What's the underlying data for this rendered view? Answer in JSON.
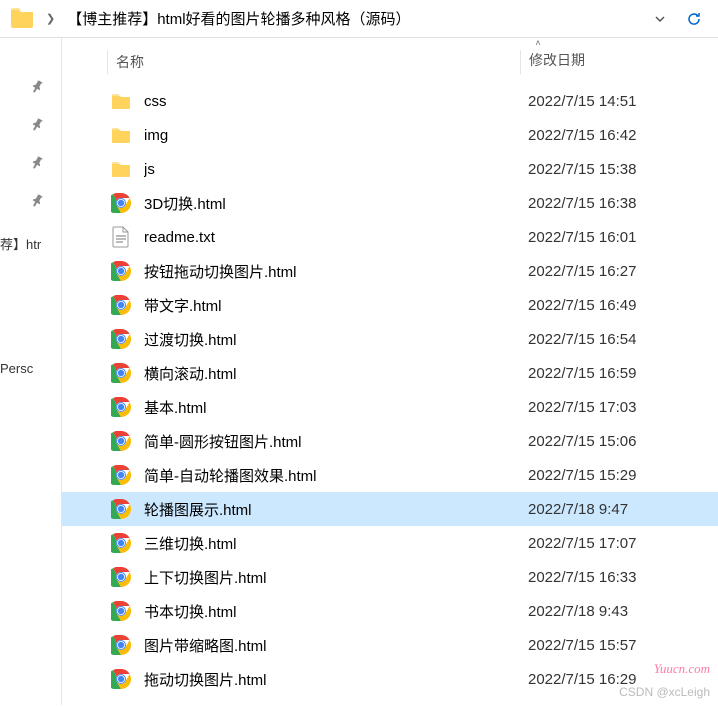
{
  "header": {
    "title": "【博主推荐】html好看的图片轮播多种风格（源码）"
  },
  "columns": {
    "name": "名称",
    "date": "修改日期"
  },
  "sidebar": {
    "item1": "荐】htr",
    "item2": "Persc"
  },
  "files": [
    {
      "icon": "folder",
      "name": "css",
      "date": "2022/7/15 14:51",
      "selected": false
    },
    {
      "icon": "folder",
      "name": "img",
      "date": "2022/7/15 16:42",
      "selected": false
    },
    {
      "icon": "folder",
      "name": "js",
      "date": "2022/7/15 15:38",
      "selected": false
    },
    {
      "icon": "chrome",
      "name": "3D切换.html",
      "date": "2022/7/15 16:38",
      "selected": false
    },
    {
      "icon": "text",
      "name": "readme.txt",
      "date": "2022/7/15 16:01",
      "selected": false
    },
    {
      "icon": "chrome",
      "name": "按钮拖动切换图片.html",
      "date": "2022/7/15 16:27",
      "selected": false
    },
    {
      "icon": "chrome",
      "name": "带文字.html",
      "date": "2022/7/15 16:49",
      "selected": false
    },
    {
      "icon": "chrome",
      "name": "过渡切换.html",
      "date": "2022/7/15 16:54",
      "selected": false
    },
    {
      "icon": "chrome",
      "name": "横向滚动.html",
      "date": "2022/7/15 16:59",
      "selected": false
    },
    {
      "icon": "chrome",
      "name": "基本.html",
      "date": "2022/7/15 17:03",
      "selected": false
    },
    {
      "icon": "chrome",
      "name": "简单-圆形按钮图片.html",
      "date": "2022/7/15 15:06",
      "selected": false
    },
    {
      "icon": "chrome",
      "name": "简单-自动轮播图效果.html",
      "date": "2022/7/15 15:29",
      "selected": false
    },
    {
      "icon": "chrome",
      "name": "轮播图展示.html",
      "date": "2022/7/18 9:47",
      "selected": true
    },
    {
      "icon": "chrome",
      "name": "三维切换.html",
      "date": "2022/7/15 17:07",
      "selected": false
    },
    {
      "icon": "chrome",
      "name": "上下切换图片.html",
      "date": "2022/7/15 16:33",
      "selected": false
    },
    {
      "icon": "chrome",
      "name": "书本切换.html",
      "date": "2022/7/18 9:43",
      "selected": false
    },
    {
      "icon": "chrome",
      "name": "图片带缩略图.html",
      "date": "2022/7/15 15:57",
      "selected": false
    },
    {
      "icon": "chrome",
      "name": "拖动切换图片.html",
      "date": "2022/7/15 16:29",
      "selected": false
    }
  ],
  "watermark1": "Yuucn.com",
  "watermark2": "CSDN @xcLeigh"
}
